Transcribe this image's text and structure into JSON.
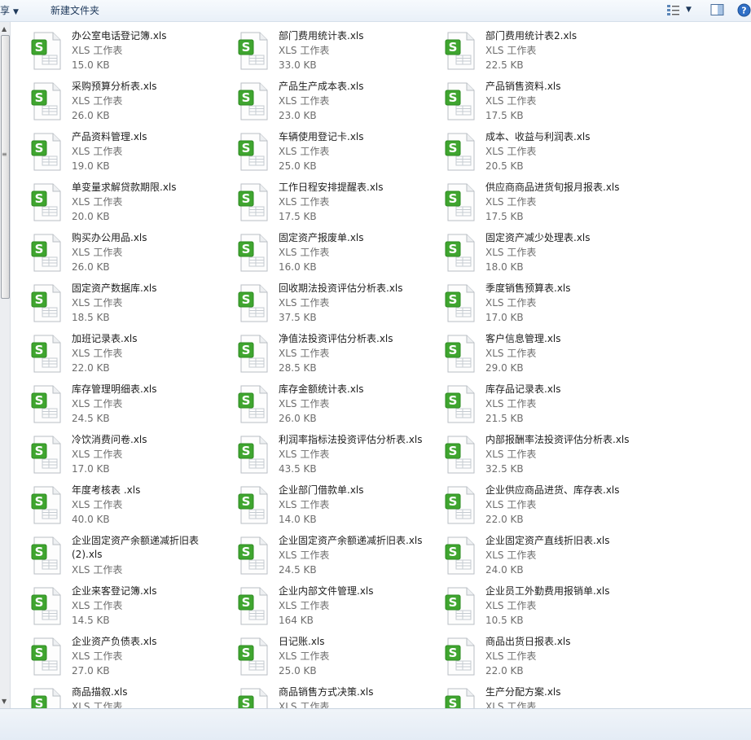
{
  "toolbar": {
    "share_label": "共享",
    "new_folder_label": "新建文件夹"
  },
  "icons": {
    "file": "spreadsheet-s-icon",
    "view": "view-options-icon",
    "preview": "preview-pane-icon",
    "help": "help-icon"
  },
  "colors": {
    "icon_green": "#3fa52f",
    "accent": "#1e395b"
  },
  "files": [
    {
      "name": "办公室电话登记簿.xls",
      "type": "XLS 工作表",
      "size": "15.0 KB"
    },
    {
      "name": "部门费用统计表.xls",
      "type": "XLS 工作表",
      "size": "33.0 KB"
    },
    {
      "name": "部门费用统计表2.xls",
      "type": "XLS 工作表",
      "size": "22.5 KB"
    },
    {
      "name": "采购预算分析表.xls",
      "type": "XLS 工作表",
      "size": "26.0 KB"
    },
    {
      "name": "产品生产成本表.xls",
      "type": "XLS 工作表",
      "size": "23.0 KB"
    },
    {
      "name": "产品销售资料.xls",
      "type": "XLS 工作表",
      "size": "17.5 KB"
    },
    {
      "name": "产品资料管理.xls",
      "type": "XLS 工作表",
      "size": "19.0 KB"
    },
    {
      "name": "车辆使用登记卡.xls",
      "type": "XLS 工作表",
      "size": "25.0 KB"
    },
    {
      "name": "成本、收益与利润表.xls",
      "type": "XLS 工作表",
      "size": "20.5 KB"
    },
    {
      "name": "单变量求解贷款期限.xls",
      "type": "XLS 工作表",
      "size": "20.0 KB"
    },
    {
      "name": "工作日程安排提醒表.xls",
      "type": "XLS 工作表",
      "size": "17.5 KB"
    },
    {
      "name": "供应商商品进货旬报月报表.xls",
      "type": "XLS 工作表",
      "size": "17.5 KB"
    },
    {
      "name": "购买办公用品.xls",
      "type": "XLS 工作表",
      "size": "26.0 KB"
    },
    {
      "name": "固定资产报废单.xls",
      "type": "XLS 工作表",
      "size": "16.0 KB"
    },
    {
      "name": "固定资产减少处理表.xls",
      "type": "XLS 工作表",
      "size": "18.0 KB"
    },
    {
      "name": "固定资产数据库.xls",
      "type": "XLS 工作表",
      "size": "18.5 KB"
    },
    {
      "name": "回收期法投资评估分析表.xls",
      "type": "XLS 工作表",
      "size": "37.5 KB"
    },
    {
      "name": "季度销售预算表.xls",
      "type": "XLS 工作表",
      "size": "17.0 KB"
    },
    {
      "name": "加班记录表.xls",
      "type": "XLS 工作表",
      "size": "22.0 KB"
    },
    {
      "name": "净值法投资评估分析表.xls",
      "type": "XLS 工作表",
      "size": "28.5 KB"
    },
    {
      "name": "客户信息管理.xls",
      "type": "XLS 工作表",
      "size": "29.0 KB"
    },
    {
      "name": "库存管理明细表.xls",
      "type": "XLS 工作表",
      "size": "24.5 KB"
    },
    {
      "name": "库存金额统计表.xls",
      "type": "XLS 工作表",
      "size": "26.0 KB"
    },
    {
      "name": "库存品记录表.xls",
      "type": "XLS 工作表",
      "size": "21.5 KB"
    },
    {
      "name": "冷饮消费问卷.xls",
      "type": "XLS 工作表",
      "size": "17.0 KB"
    },
    {
      "name": "利润率指标法投资评估分析表.xls",
      "type": "XLS 工作表",
      "size": "43.5 KB"
    },
    {
      "name": "内部报酬率法投资评估分析表.xls",
      "type": "XLS 工作表",
      "size": "32.5 KB"
    },
    {
      "name": "年度考核表 .xls",
      "type": "XLS 工作表",
      "size": "40.0 KB"
    },
    {
      "name": "企业部门借款单.xls",
      "type": "XLS 工作表",
      "size": "14.0 KB"
    },
    {
      "name": "企业供应商品进货、库存表.xls",
      "type": "XLS 工作表",
      "size": "22.0 KB"
    },
    {
      "name": "企业固定资产余额递减折旧表\n(2).xls",
      "type": "XLS 工作表",
      "size": ""
    },
    {
      "name": "企业固定资产余额递减折旧表.xls",
      "type": "XLS 工作表",
      "size": "24.5 KB"
    },
    {
      "name": "企业固定资产直线折旧表.xls",
      "type": "XLS 工作表",
      "size": "24.0 KB"
    },
    {
      "name": "企业来客登记簿.xls",
      "type": "XLS 工作表",
      "size": "14.5 KB"
    },
    {
      "name": "企业内部文件管理.xls",
      "type": "XLS 工作表",
      "size": "164 KB"
    },
    {
      "name": "企业员工外勤费用报销单.xls",
      "type": "XLS 工作表",
      "size": "10.5 KB"
    },
    {
      "name": "企业资产负债表.xls",
      "type": "XLS 工作表",
      "size": "27.0 KB"
    },
    {
      "name": "日记账.xls",
      "type": "XLS 工作表",
      "size": "25.0 KB"
    },
    {
      "name": "商品出货日报表.xls",
      "type": "XLS 工作表",
      "size": "22.0 KB"
    },
    {
      "name": "商品描叙.xls",
      "type": "XLS 工作表",
      "size": ""
    },
    {
      "name": "商品销售方式决策.xls",
      "type": "XLS 工作表",
      "size": ""
    },
    {
      "name": "生产分配方案.xls",
      "type": "XLS 工作表",
      "size": ""
    }
  ]
}
